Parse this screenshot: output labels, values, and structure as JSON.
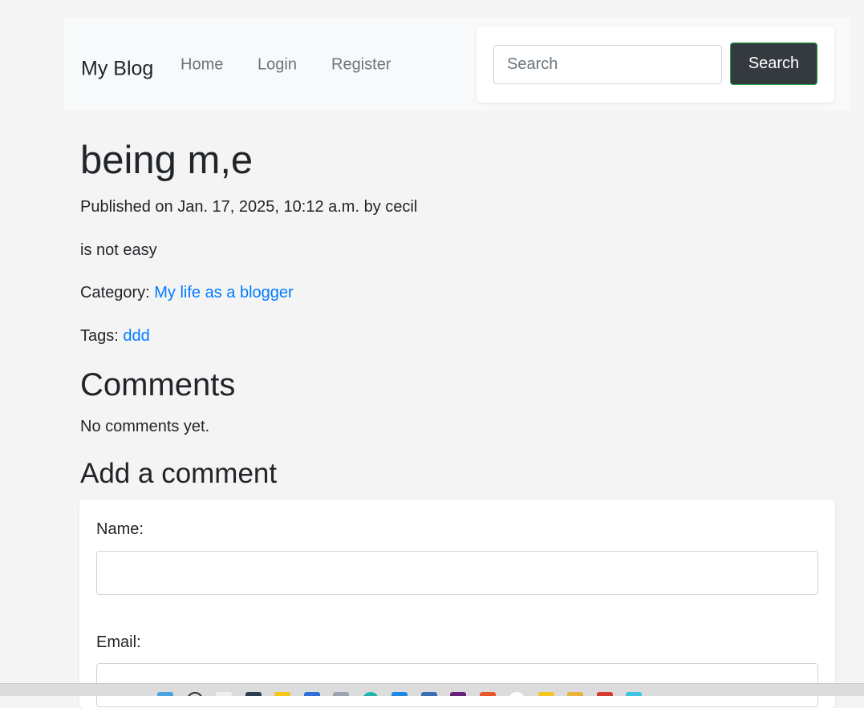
{
  "navbar": {
    "brand": "My Blog",
    "links": [
      "Home",
      "Login",
      "Register"
    ],
    "search": {
      "placeholder": "Search",
      "value": "",
      "button_label": "Search"
    }
  },
  "post": {
    "title": "being m,e",
    "published": "Published on Jan. 17, 2025, 10:12 a.m. by cecil",
    "body": "is not easy",
    "category_label": "Category: ",
    "category": "My life as a blogger",
    "tags_label": "Tags: ",
    "tags": [
      "ddd"
    ]
  },
  "comments": {
    "heading": "Comments",
    "empty_text": "No comments yet."
  },
  "comment_form": {
    "heading": "Add a comment",
    "name_label": "Name:",
    "name_value": "",
    "email_label": "Email:",
    "email_value": ""
  },
  "taskbar": {
    "icons": [
      {
        "name": "windows-start-icon",
        "color": "#4aa3df"
      },
      {
        "name": "search-icon",
        "color": "#333333"
      },
      {
        "name": "file-icon",
        "color": "#eeeeee"
      },
      {
        "name": "task-view-icon",
        "color": "#2d3e50"
      },
      {
        "name": "lightning-icon",
        "color": "#f5c518"
      },
      {
        "name": "calendar-icon",
        "color": "#2f6fd6"
      },
      {
        "name": "window-icon",
        "color": "#9aa5b1"
      },
      {
        "name": "browser-icon",
        "color": "#1fb5a8"
      },
      {
        "name": "edge-icon",
        "color": "#1e88e5"
      },
      {
        "name": "store-icon",
        "color": "#3b6fb5"
      },
      {
        "name": "visual-studio-icon",
        "color": "#68217a"
      },
      {
        "name": "app-orange-icon",
        "color": "#e8562a"
      },
      {
        "name": "chrome-icon",
        "color": "#ffffff"
      },
      {
        "name": "app-yellow-icon",
        "color": "#f3c623"
      },
      {
        "name": "folder-icon",
        "color": "#e8b53a"
      },
      {
        "name": "app-red-icon",
        "color": "#d63b2f"
      },
      {
        "name": "app-cyan-icon",
        "color": "#3ec6e0"
      }
    ]
  }
}
